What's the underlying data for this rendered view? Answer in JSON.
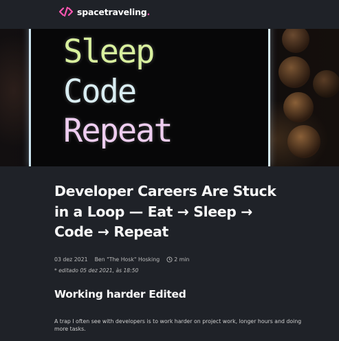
{
  "header": {
    "logo_icon": "code-brackets-icon",
    "logo_text": "spacetraveling",
    "logo_dot": ".",
    "accent_color": "#ff57b2"
  },
  "banner": {
    "lines": [
      "Sleep",
      "Code",
      "Repeat"
    ]
  },
  "post": {
    "title": "Developer Careers Are Stuck in a Loop — Eat → Sleep → Code → Repeat",
    "date": "03 dez 2021",
    "author": "Ben \"The Hosk\" Hosking",
    "reading_time": "2 min",
    "edited": "* editado 05 dez 2021, às 18:50",
    "section_heading": "Working harder Edited",
    "paragraph": "A trap I often see with developers is to work harder on project work, longer hours and doing more tasks."
  }
}
